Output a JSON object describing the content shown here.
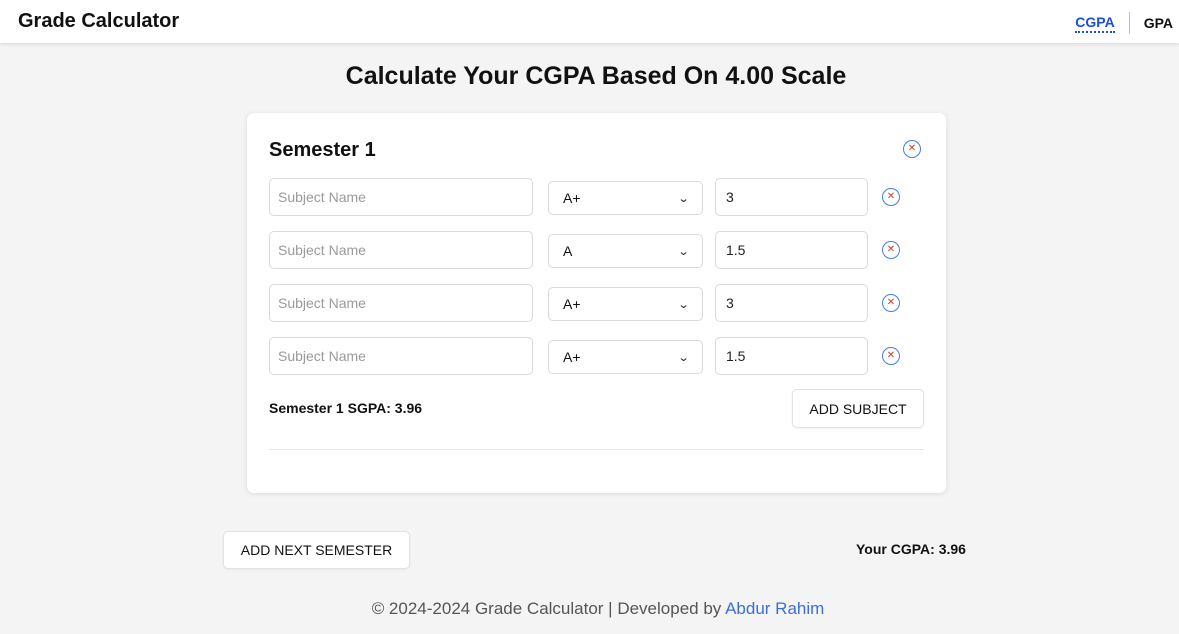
{
  "header": {
    "brand": "Grade Calculator",
    "nav": [
      {
        "label": "CGPA",
        "active": true
      },
      {
        "label": "GPA",
        "active": false
      }
    ]
  },
  "page_title": "Calculate Your CGPA Based On 4.00 Scale",
  "semesters": [
    {
      "title": "Semester 1",
      "remove_icon": "close-icon",
      "subjects": [
        {
          "name": "",
          "name_placeholder": "Subject Name",
          "grade": "A+",
          "credit": "3",
          "remove_icon": "close-icon"
        },
        {
          "name": "",
          "name_placeholder": "Subject Name",
          "grade": "A",
          "credit": "1.5",
          "remove_icon": "close-icon"
        },
        {
          "name": "",
          "name_placeholder": "Subject Name",
          "grade": "A+",
          "credit": "3",
          "remove_icon": "close-icon"
        },
        {
          "name": "",
          "name_placeholder": "Subject Name",
          "grade": "A+",
          "credit": "1.5",
          "remove_icon": "close-icon"
        }
      ],
      "sgpa_text": "Semester 1 SGPA: 3.96",
      "add_subject_label": "ADD SUBJECT"
    }
  ],
  "add_semester_label": "ADD NEXT SEMESTER",
  "cgpa_text": "Your CGPA: 3.96",
  "footer": {
    "text": "© 2024-2024 Grade Calculator | Developed by ",
    "author": "Abdur Rahim"
  },
  "colors": {
    "accent": "#1a4fd6",
    "remove_border": "#3f7ee8",
    "remove_x": "#d23b2c",
    "link": "#3b6fd8",
    "background": "#f4f4f4"
  }
}
